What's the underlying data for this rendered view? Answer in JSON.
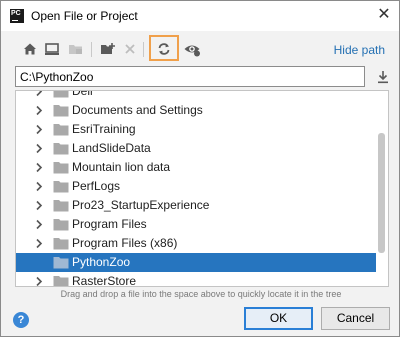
{
  "window": {
    "title": "Open File or Project",
    "app_icon_text": "PC",
    "close_glyph": "✕"
  },
  "toolbar": {
    "buttons": [
      {
        "name": "home-icon"
      },
      {
        "name": "desktop-icon"
      },
      {
        "name": "project-folder-icon"
      },
      {
        "name": "new-folder-icon"
      },
      {
        "name": "delete-icon"
      },
      {
        "name": "refresh-icon"
      },
      {
        "name": "show-hidden-icon"
      }
    ],
    "hide_path_label": "Hide path",
    "highlight_color": "#f0a04b",
    "link_color": "#2470b3"
  },
  "path": {
    "value": "C:\\PythonZoo"
  },
  "tree": {
    "items": [
      {
        "label": "Dell",
        "selected": false
      },
      {
        "label": "Documents and Settings",
        "selected": false
      },
      {
        "label": "EsriTraining",
        "selected": false
      },
      {
        "label": "LandSlideData",
        "selected": false
      },
      {
        "label": "Mountain lion data",
        "selected": false
      },
      {
        "label": "PerfLogs",
        "selected": false
      },
      {
        "label": "Pro23_StartupExperience",
        "selected": false
      },
      {
        "label": "Program Files",
        "selected": false
      },
      {
        "label": "Program Files (x86)",
        "selected": false
      },
      {
        "label": "PythonZoo",
        "selected": true
      },
      {
        "label": "RasterStore",
        "selected": false
      }
    ],
    "selected_color": "#2675bf"
  },
  "hint": "Drag and drop a file into the space above to quickly locate it in the tree",
  "footer": {
    "help_label": "?",
    "ok_label": "OK",
    "cancel_label": "Cancel"
  }
}
